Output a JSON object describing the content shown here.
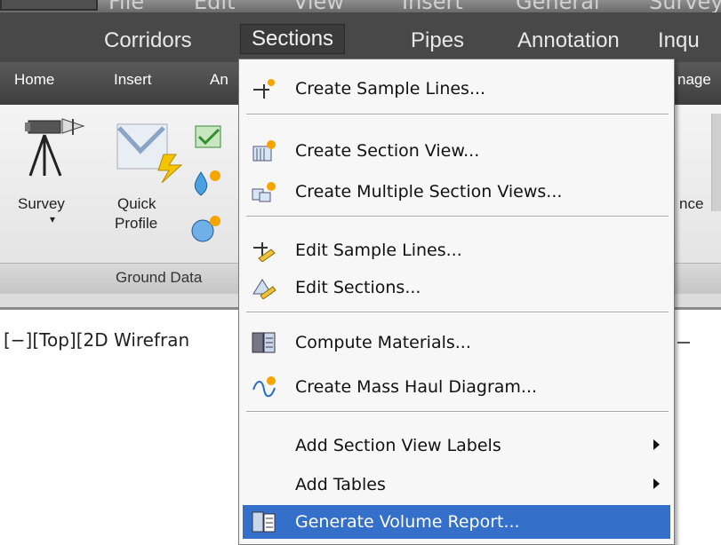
{
  "classic_menu": {
    "ghost_items": [
      "File",
      "Edit",
      "View",
      "Insert",
      "General",
      "Survey"
    ]
  },
  "menubar": {
    "items": [
      "Corridors",
      "Sections",
      "Pipes",
      "Annotation",
      "Inqu"
    ]
  },
  "ribbon_tabs": [
    "Home",
    "Insert",
    "An",
    "nage"
  ],
  "ribbon": {
    "survey_label": "Survey",
    "survey_arrow": "▾",
    "quick_label_1": "Quick",
    "quick_label_2": "Profile",
    "nce_label": "nce",
    "panel_label": "Ground Data"
  },
  "viewport": {
    "label": "[−][Top][2D Wirefran"
  },
  "dropdown": {
    "items": [
      {
        "label": "Create Sample Lines...",
        "icon": "create-sample-lines-icon",
        "has_submenu": false
      },
      {
        "label": "Create Section View...",
        "icon": "create-section-view-icon",
        "has_submenu": false
      },
      {
        "label": "Create Multiple Section Views...",
        "icon": "create-multiple-section-views-icon",
        "has_submenu": false
      },
      {
        "label": "Edit Sample Lines...",
        "icon": "edit-sample-lines-icon",
        "has_submenu": false
      },
      {
        "label": "Edit Sections...",
        "icon": "edit-sections-icon",
        "has_submenu": false
      },
      {
        "label": "Compute Materials...",
        "icon": "compute-materials-icon",
        "has_submenu": false
      },
      {
        "label": "Create Mass Haul Diagram...",
        "icon": "mass-haul-diagram-icon",
        "has_submenu": false
      },
      {
        "label": "Add Section View Labels",
        "icon": "",
        "has_submenu": true
      },
      {
        "label": "Add Tables",
        "icon": "",
        "has_submenu": true
      },
      {
        "label": "Generate Volume Report...",
        "icon": "volume-report-icon",
        "has_submenu": false,
        "highlighted": true
      }
    ]
  },
  "colors": {
    "highlight": "#3470c9",
    "menubar": "#484848"
  }
}
